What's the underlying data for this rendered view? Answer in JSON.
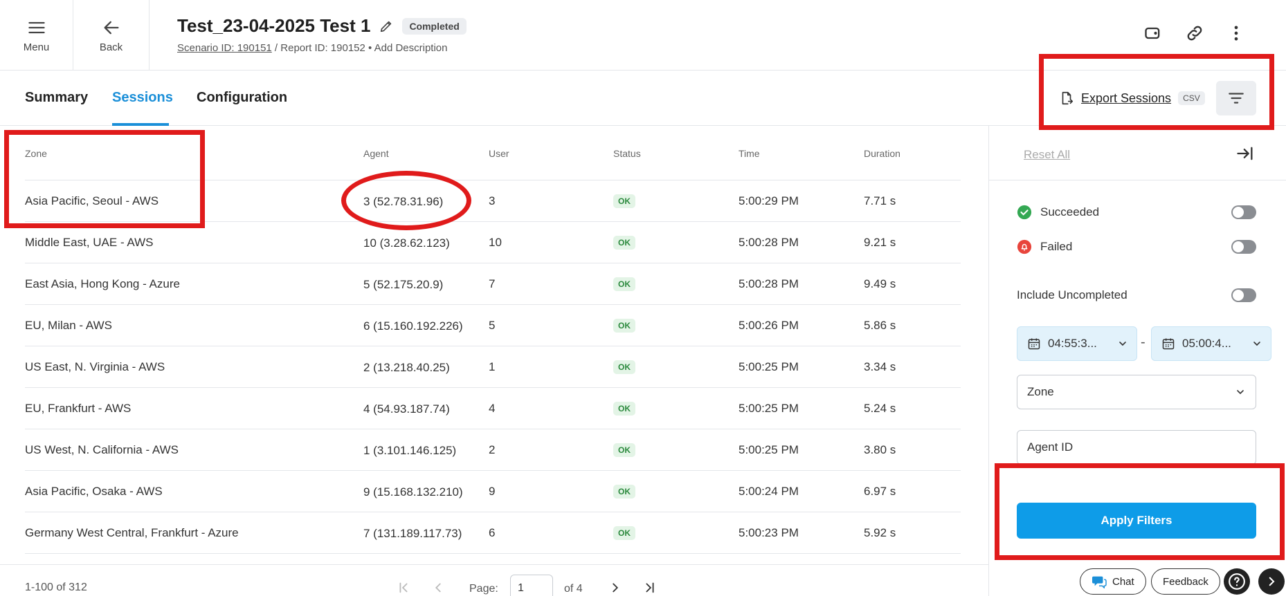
{
  "header": {
    "menu_label": "Menu",
    "back_label": "Back",
    "title": "Test_23-04-2025 Test 1",
    "status_badge": "Completed",
    "scenario_link": "Scenario ID: 190151",
    "report_text": " / Report ID: 190152 • ",
    "add_description": "Add Description",
    "icons": [
      "tag-icon",
      "link-icon",
      "more-vertical-icon"
    ]
  },
  "tabs": [
    {
      "label": "Summary",
      "active": false
    },
    {
      "label": "Sessions",
      "active": true
    },
    {
      "label": "Configuration",
      "active": false
    }
  ],
  "toolbar": {
    "export_label": "Export Sessions",
    "export_format": "CSV"
  },
  "table": {
    "columns": [
      "Zone",
      "Agent",
      "User",
      "Status",
      "Time",
      "Duration"
    ],
    "rows": [
      {
        "zone": "Asia Pacific, Seoul - AWS",
        "agent": "3 (52.78.31.96)",
        "user": "3",
        "status": "OK",
        "time": "5:00:29 PM",
        "duration": "7.71 s"
      },
      {
        "zone": "Middle East, UAE - AWS",
        "agent": "10 (3.28.62.123)",
        "user": "10",
        "status": "OK",
        "time": "5:00:28 PM",
        "duration": "9.21 s"
      },
      {
        "zone": "East Asia, Hong Kong - Azure",
        "agent": "5 (52.175.20.9)",
        "user": "7",
        "status": "OK",
        "time": "5:00:28 PM",
        "duration": "9.49 s"
      },
      {
        "zone": "EU, Milan - AWS",
        "agent": "6 (15.160.192.226)",
        "user": "5",
        "status": "OK",
        "time": "5:00:26 PM",
        "duration": "5.86 s"
      },
      {
        "zone": "US East, N. Virginia - AWS",
        "agent": "2 (13.218.40.25)",
        "user": "1",
        "status": "OK",
        "time": "5:00:25 PM",
        "duration": "3.34 s"
      },
      {
        "zone": "EU, Frankfurt - AWS",
        "agent": "4 (54.93.187.74)",
        "user": "4",
        "status": "OK",
        "time": "5:00:25 PM",
        "duration": "5.24 s"
      },
      {
        "zone": "US West, N. California - AWS",
        "agent": "1 (3.101.146.125)",
        "user": "2",
        "status": "OK",
        "time": "5:00:25 PM",
        "duration": "3.80 s"
      },
      {
        "zone": "Asia Pacific, Osaka - AWS",
        "agent": "9 (15.168.132.210)",
        "user": "9",
        "status": "OK",
        "time": "5:00:24 PM",
        "duration": "6.97 s"
      },
      {
        "zone": "Germany West Central, Frankfurt - Azure",
        "agent": "7 (131.189.117.73)",
        "user": "6",
        "status": "OK",
        "time": "5:00:23 PM",
        "duration": "5.92 s"
      }
    ]
  },
  "pagination": {
    "range": "1-100 of 312",
    "page_label": "Page:",
    "current_page": "1",
    "of_label": "of 4"
  },
  "filters": {
    "reset_label": "Reset All",
    "succeeded_label": "Succeeded",
    "failed_label": "Failed",
    "include_uncompleted_label": "Include Uncompleted",
    "start_time": "04:55:3...",
    "date_separator": "-",
    "end_time": "05:00:4...",
    "zone_select": "Zone",
    "agent_id_placeholder": "Agent ID",
    "apply_label": "Apply Filters",
    "colors": {
      "accent": "#0e9ce8",
      "succeeded": "#34a853",
      "failed": "#e8453c"
    }
  },
  "footer_buttons": {
    "chat_label": "Chat",
    "feedback_label": "Feedback"
  }
}
